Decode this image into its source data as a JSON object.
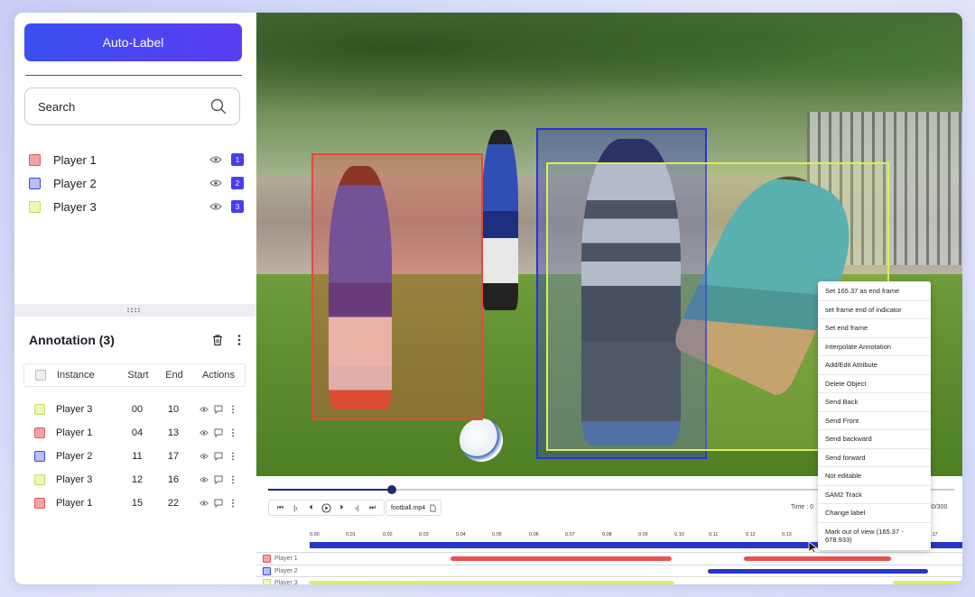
{
  "left_panel": {
    "auto_label": "Auto-Label",
    "search_placeholder": "Search",
    "classes": [
      {
        "name": "Player 1",
        "badge": "1",
        "color": "#f4a3a3",
        "border": "#e0585a"
      },
      {
        "name": "Player 2",
        "badge": "2",
        "color": "#b9bdf5",
        "border": "#3d46d8"
      },
      {
        "name": "Player 3",
        "badge": "3",
        "color": "#eef7b0",
        "border": "#c9d86a"
      }
    ]
  },
  "annotation": {
    "title": "Annotation (3)",
    "columns": [
      "Instance",
      "Start",
      "End",
      "Actions"
    ],
    "rows": [
      {
        "instance": "Player 3",
        "start": "00",
        "end": "10"
      },
      {
        "instance": "Player 1",
        "start": "04",
        "end": "13"
      },
      {
        "instance": "Player 2",
        "start": "11",
        "end": "17"
      },
      {
        "instance": "Player 3",
        "start": "12",
        "end": "16"
      },
      {
        "instance": "Player 1",
        "start": "15",
        "end": "22"
      }
    ]
  },
  "context_menu": [
    "Set 165.37 as end frame",
    "set frame end of indicator",
    "Set end frame",
    "Interpolate Annotation",
    "Add/Edit Attribute",
    "Delete Object",
    "Send Back",
    "Send Front",
    "Send backward",
    "Send forward",
    "Not editable",
    "SAM2 Track",
    "Change label",
    "Mark out of view (165.37 - 678.933)"
  ],
  "timeline": {
    "file_name": "football.mp4",
    "time_prefix": "Time : 0",
    "time_suffix": "20/300",
    "progress": 0.18,
    "ticks": [
      "0.00",
      "0.01",
      "0.02",
      "0.03",
      "0.04",
      "0.05",
      "0.06",
      "0.07",
      "0.08",
      "0.09",
      "0.10",
      "0.11",
      "0.12",
      "0.13",
      "0.17"
    ],
    "tracks": [
      {
        "name": "Player 1",
        "color": "#e8524f"
      },
      {
        "name": "Player 2",
        "color": "#2a35c9"
      },
      {
        "name": "Player 3",
        "color": "#dbee66"
      }
    ]
  }
}
